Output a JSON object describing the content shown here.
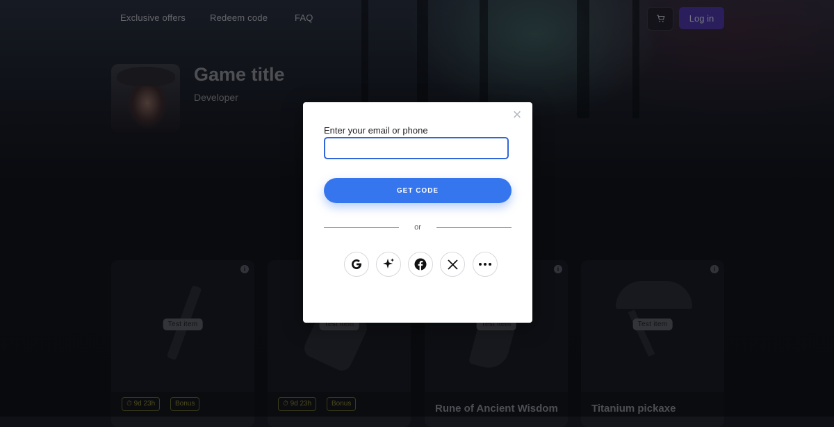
{
  "nav": {
    "links": [
      "Exclusive offers",
      "Redeem code",
      "FAQ"
    ],
    "cart_icon": "cart-icon",
    "login_label": "Log in"
  },
  "game": {
    "title": "Game title",
    "developer": "Developer"
  },
  "cards": [
    {
      "badge": "Test item",
      "timer": "9d 23h",
      "bonus": "Bonus",
      "name": ""
    },
    {
      "badge": "Test item",
      "timer": "9d 23h",
      "bonus": "Bonus",
      "name": ""
    },
    {
      "badge": "Test item",
      "timer": "",
      "bonus": "",
      "name": "Rune of Ancient Wisdom"
    },
    {
      "badge": "Test item",
      "timer": "",
      "bonus": "",
      "name": "Titanium pickaxe"
    }
  ],
  "modal": {
    "field_label": "Enter your email or phone",
    "input_value": "",
    "input_placeholder": "",
    "submit_label": "GET CODE",
    "or_text": "or",
    "social_icons": [
      "google-icon",
      "sparkle-icon",
      "facebook-icon",
      "x-icon",
      "more-icon"
    ]
  },
  "colors": {
    "accent": "#3576ee",
    "login_button": "#4e3aa8",
    "tag_border": "#6b6a2a"
  }
}
